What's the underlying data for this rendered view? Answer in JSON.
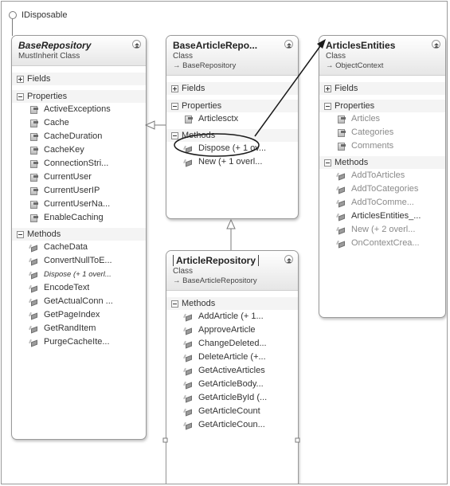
{
  "interface_label": "IDisposable",
  "classes": {
    "base_repository": {
      "title": "BaseRepository",
      "subtitle": "MustInherit Class",
      "fields_label": "Fields",
      "properties_label": "Properties",
      "properties": [
        "ActiveExceptions",
        "Cache",
        "CacheDuration",
        "CacheKey",
        "ConnectionStri...",
        "CurrentUser",
        "CurrentUserIP",
        "CurrentUserNa...",
        "EnableCaching"
      ],
      "methods_label": "Methods",
      "methods": [
        "CacheData",
        "ConvertNullToE...",
        "Dispose (+ 1 overl...",
        "EncodeText",
        "GetActualConn ...",
        "GetPageIndex",
        "GetRandItem",
        "PurgeCacheIte..."
      ]
    },
    "base_article_repository": {
      "title": "BaseArticleRepo...",
      "subtitle": "Class",
      "parent": "→ BaseRepository",
      "fields_label": "Fields",
      "properties_label": "Properties",
      "properties": [
        "Articlesctx"
      ],
      "methods_label": "Methods",
      "methods": [
        "Dispose (+ 1 ov...",
        "New (+ 1 overl..."
      ]
    },
    "articles_entities": {
      "title": "ArticlesEntities",
      "subtitle": "Class",
      "parent": "→ ObjectContext",
      "fields_label": "Fields",
      "properties_label": "Properties",
      "properties": [
        "Articles",
        "Categories",
        "Comments"
      ],
      "methods_label": "Methods",
      "methods": [
        "AddToArticles",
        "AddToCategories",
        "AddToComme...",
        "ArticlesEntities_...",
        "New (+ 2 overl...",
        "OnContextCrea..."
      ]
    },
    "article_repository": {
      "title": "ArticleRepository",
      "subtitle": "Class",
      "parent": "→ BaseArticleRepository",
      "methods_label": "Methods",
      "methods": [
        "AddArticle (+ 1...",
        "ApproveArticle",
        "ChangeDeleted...",
        "DeleteArticle (+...",
        "GetActiveArticles",
        "GetArticleBody...",
        "GetArticleById (...",
        "GetArticleCount",
        "GetArticleCoun..."
      ]
    }
  },
  "colors": {
    "line": "#7a7a7a",
    "arrow": "#222222",
    "box_border": "#9a9a9a",
    "faded_text": "#8a8a8a"
  }
}
